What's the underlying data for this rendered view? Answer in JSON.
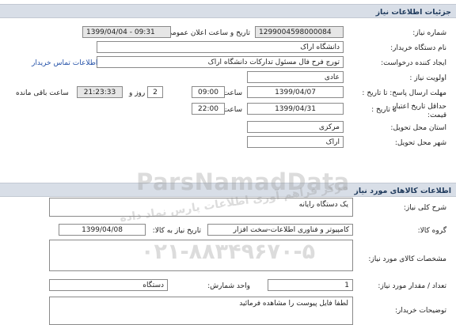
{
  "page": {
    "title": "جزئیات اطلاعات نیاز",
    "need_number": {
      "label": "شماره نیاز:",
      "value": "1299004598000084"
    },
    "announce": {
      "label": "تاریخ و ساعت اعلان عمومی:",
      "value": "1399/04/04 - 09:31"
    },
    "buyer_name": {
      "label": "نام دستگاه خریدار:",
      "value": "دانشگاه اراک"
    },
    "creator": {
      "label": "ایجاد کننده درخواست:",
      "value": "تورج فرح فال مسئول تدارکات دانشگاه اراک",
      "link": "اطلاعات تماس خریدار"
    },
    "priority": {
      "label": "اولویت نیاز :",
      "value": "عادی"
    },
    "reply_deadline": {
      "label": "مهلت ارسال پاسخ: تا تاریخ :",
      "date": "1399/04/07",
      "time_label": "ساعت",
      "time": "09:00",
      "days": "2",
      "days_label": "روز و",
      "remaining": "21:23:33",
      "remaining_label": "ساعت باقی مانده"
    },
    "price_validity": {
      "label1": "حداقل تاریخ اعتبار",
      "label2": "قیمت:",
      "date_label": "تا تاریخ :",
      "date": "1399/04/31",
      "time_label": "ساعت",
      "time": "22:00"
    },
    "province": {
      "label": "استان محل تحویل:",
      "value": "مرکزی"
    },
    "city": {
      "label": "شهر محل تحویل:",
      "value": "اراک"
    }
  },
  "goods": {
    "title": "اطلاعات کالاهای مورد نیاز",
    "summary": {
      "label": "شرح کلی نیاز:",
      "value": "یک دستگاه رایانه"
    },
    "group": {
      "label": "گروه کالا:",
      "value": "کامپیوتر و فناوری اطلاعات-سخت افزار",
      "date_label": "تاریخ نیاز به کالا:",
      "date": "1399/04/08"
    },
    "specs": {
      "label": "مشخصات کالای مورد نیاز:",
      "value": ""
    },
    "qty": {
      "label": "تعداد / مقدار مورد نیاز:",
      "value": "1",
      "unit_label": "واحد شمارش:",
      "unit": "دستگاه"
    },
    "buyer_notes": {
      "label": "توضیحات خریدار:",
      "value": "لطفا فایل پیوست را مشاهده فرمائید"
    }
  },
  "watermark": {
    "brand": "ParsNamadData",
    "slogan": "مرکز فراهم آوری اطلاعات پارس نماد داده",
    "phone": "۰۲۱-۸۸۳۴۹۶۷۰-۵"
  }
}
